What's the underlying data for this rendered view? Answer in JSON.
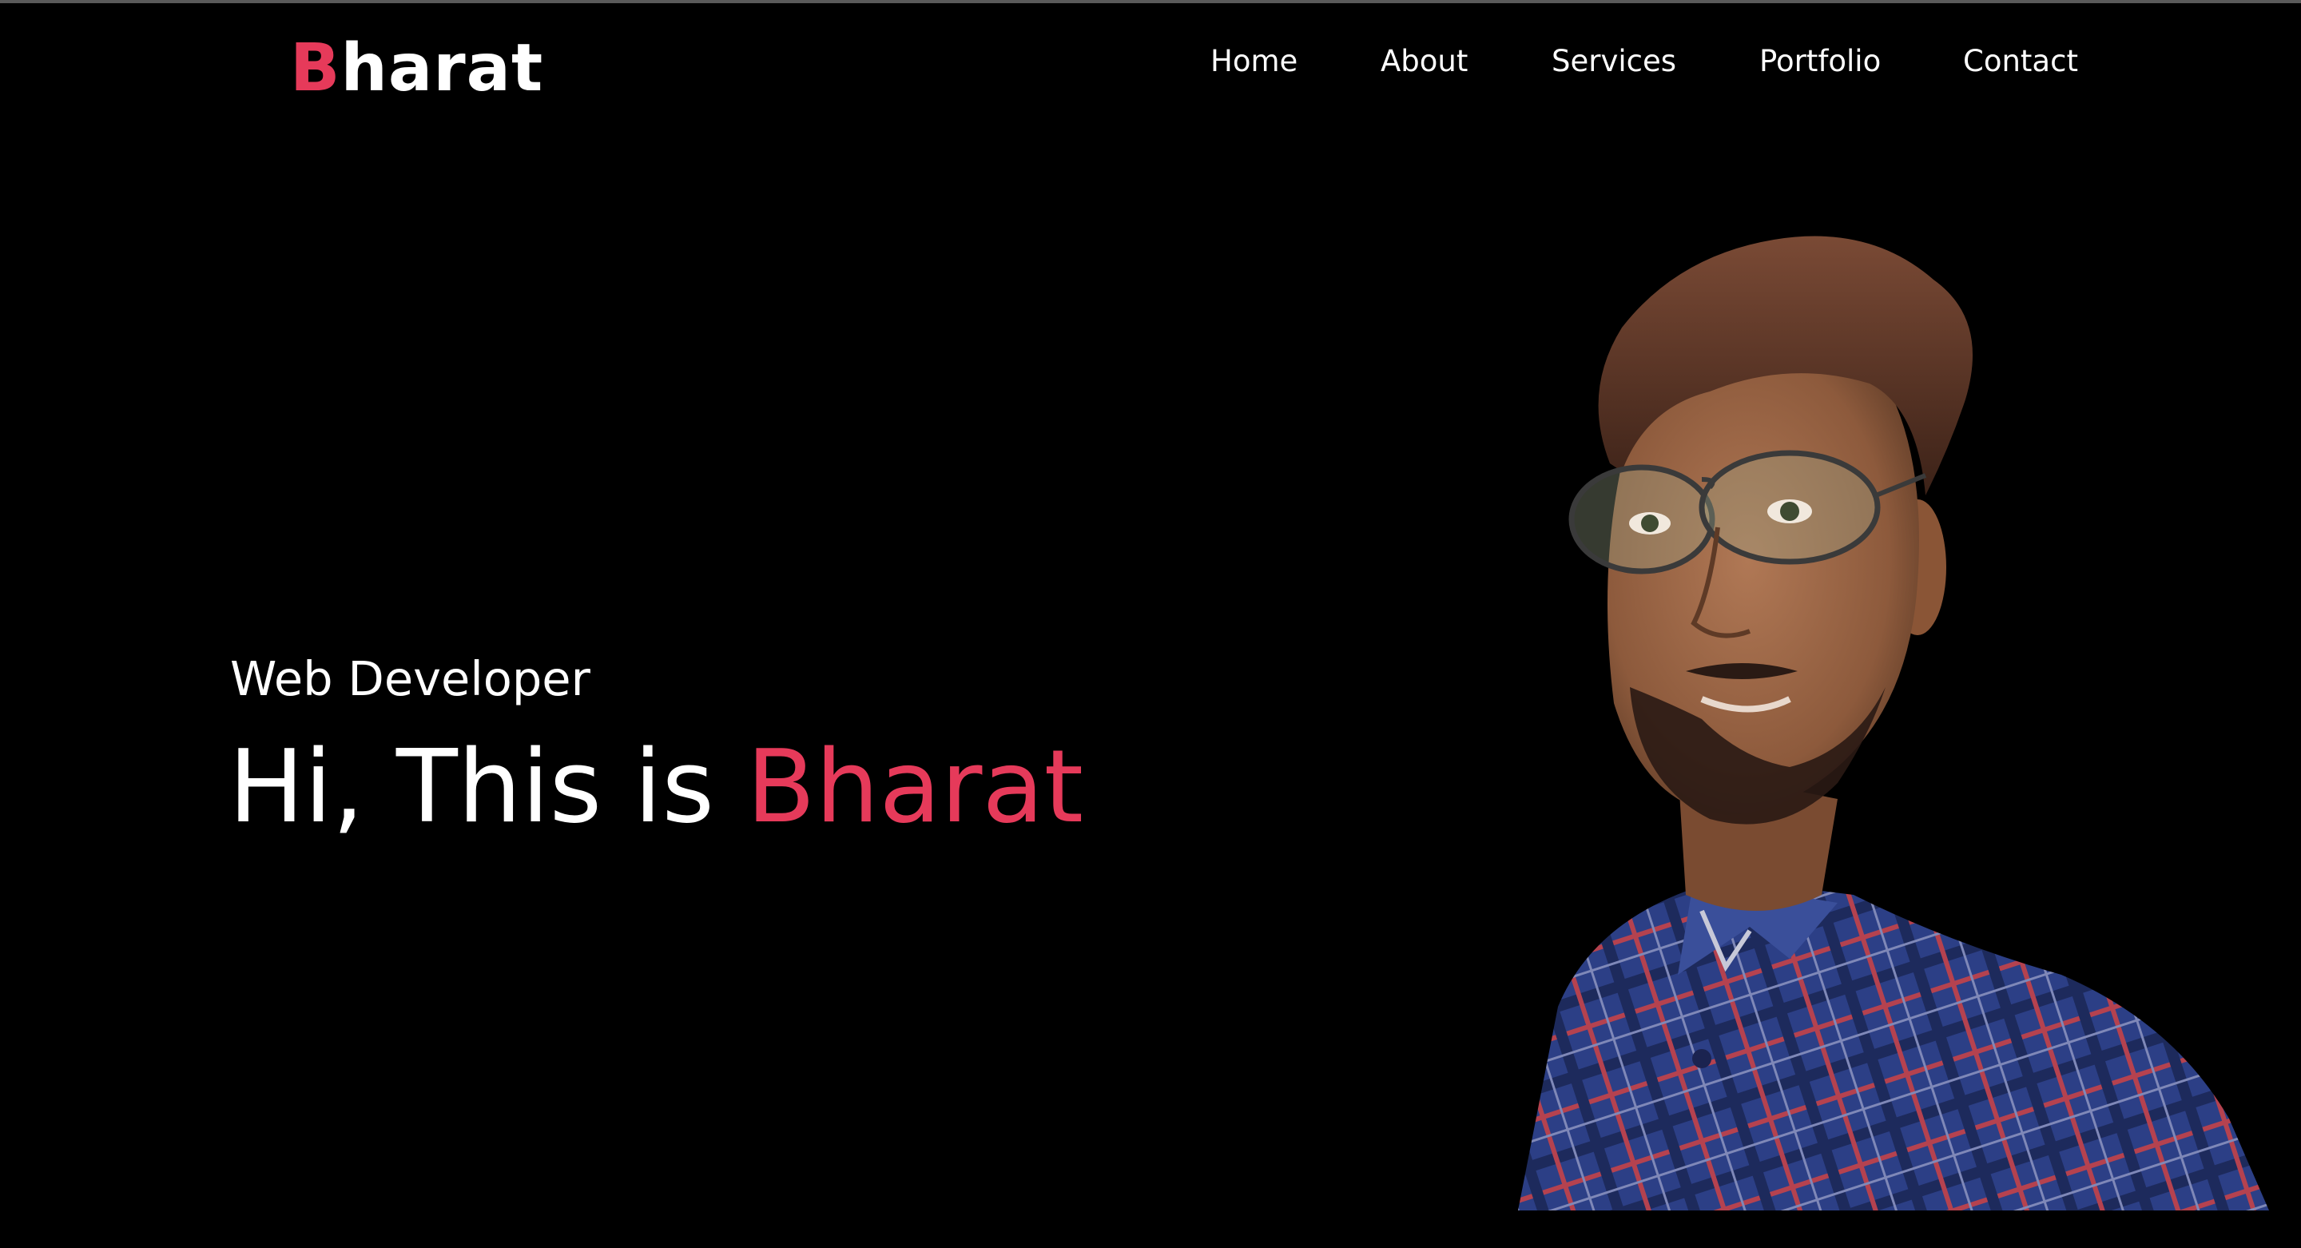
{
  "logo": {
    "accent_letter": "B",
    "rest": "harat",
    "accent_color": "#e63a5a"
  },
  "nav": {
    "items": [
      {
        "label": "Home"
      },
      {
        "label": "About"
      },
      {
        "label": "Services"
      },
      {
        "label": "Portfolio"
      },
      {
        "label": "Contact"
      }
    ]
  },
  "hero": {
    "subtitle": "Web Developer",
    "greeting": "Hi, This is ",
    "name": "Bharat",
    "accent_color": "#e63a5a"
  },
  "portrait": {
    "description": "portrait-photo"
  }
}
